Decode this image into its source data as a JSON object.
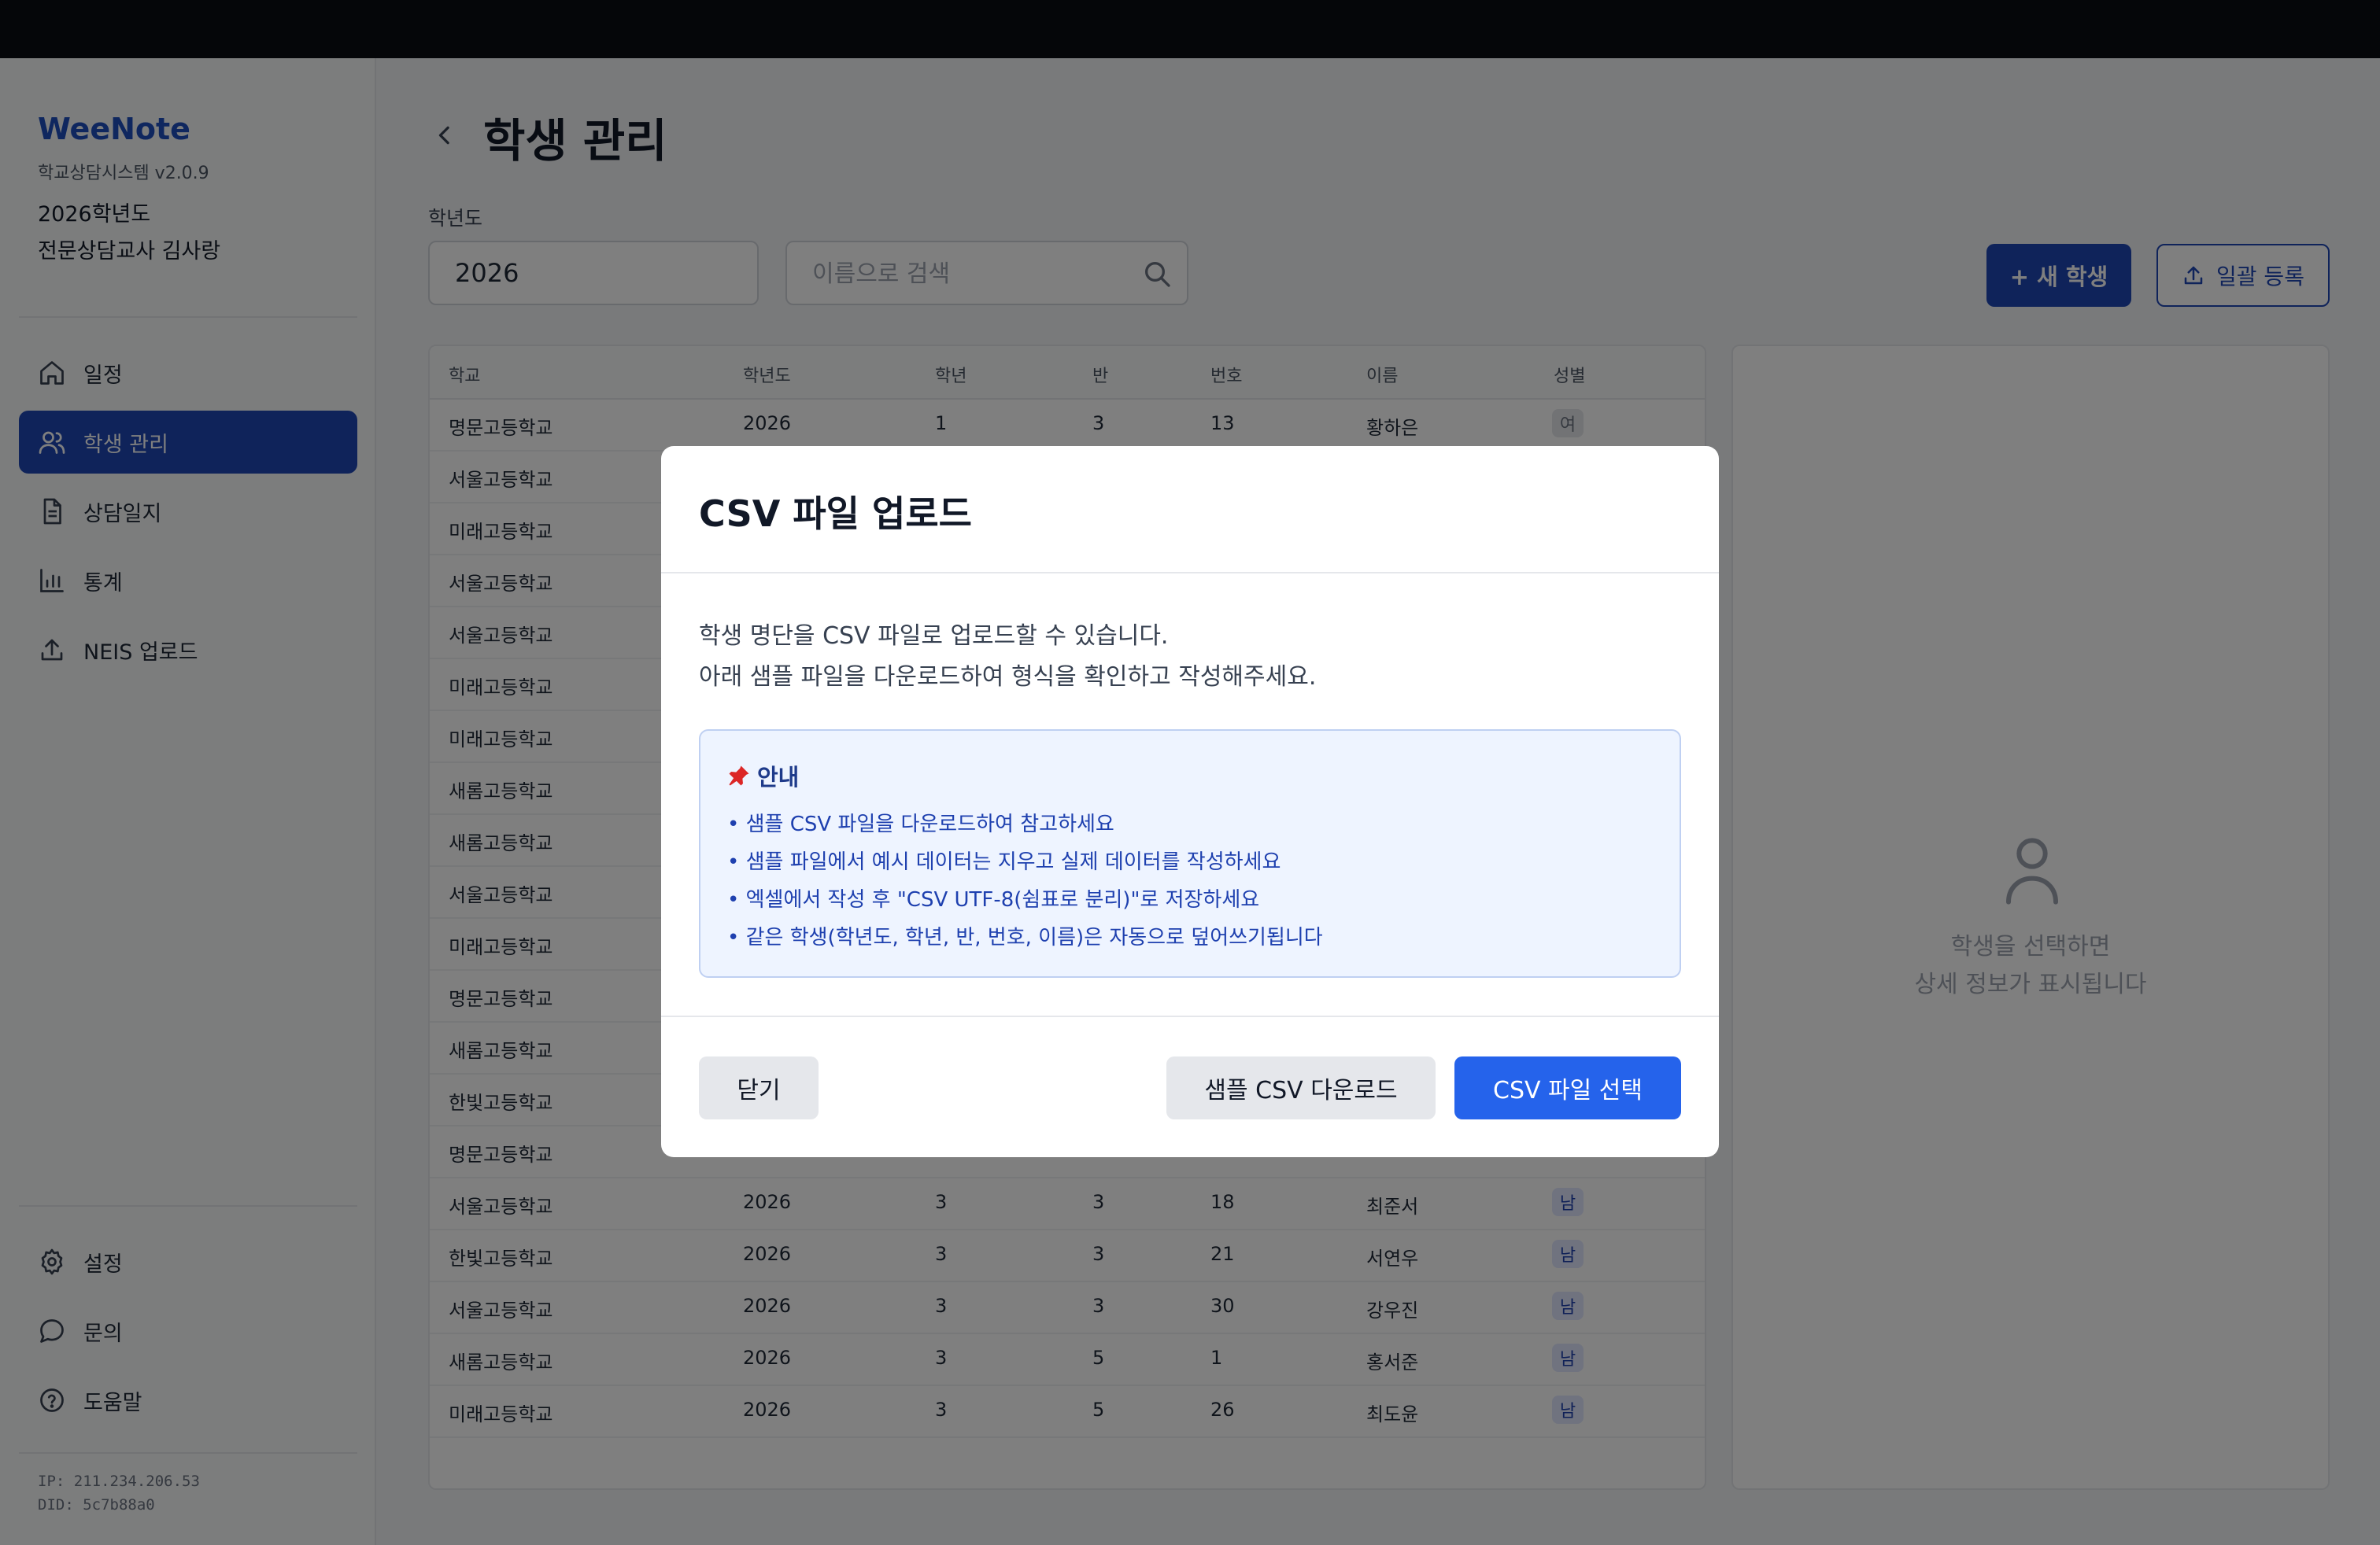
{
  "sidebar": {
    "brand": "WeeNote",
    "version": "학교상담시스템 v2.0.9",
    "school_year": "2026학년도",
    "user": "전문상담교사 김사랑",
    "nav": [
      {
        "label": "일정",
        "icon": "home-icon"
      },
      {
        "label": "학생 관리",
        "icon": "users-icon",
        "active": true
      },
      {
        "label": "상담일지",
        "icon": "document-icon"
      },
      {
        "label": "통계",
        "icon": "bar-chart-icon"
      },
      {
        "label": "NEIS 업로드",
        "icon": "upload-icon"
      }
    ],
    "bottom_nav": [
      {
        "label": "설정",
        "icon": "gear-icon"
      },
      {
        "label": "문의",
        "icon": "chat-bubble-icon"
      },
      {
        "label": "도움말",
        "icon": "help-circle-icon"
      }
    ],
    "ip": "IP: 211.234.206.53",
    "did": "DID: 5c7b88a0"
  },
  "main": {
    "title": "학생 관리",
    "year_label": "학년도",
    "year_value": "2026",
    "search_placeholder": "이름으로 검색",
    "new_button": "+ 새 학생",
    "bulk_button": "일괄 등록"
  },
  "table": {
    "headers": [
      "학교",
      "학년도",
      "학년",
      "반",
      "번호",
      "이름",
      "성별"
    ],
    "rows": [
      {
        "school": "명문고등학교",
        "year": "2026",
        "grade": "1",
        "class": "3",
        "number": "13",
        "name": "황하은",
        "gender": "여"
      },
      {
        "school": "서울고등학교"
      },
      {
        "school": "미래고등학교"
      },
      {
        "school": "서울고등학교"
      },
      {
        "school": "서울고등학교"
      },
      {
        "school": "미래고등학교"
      },
      {
        "school": "미래고등학교"
      },
      {
        "school": "새롬고등학교"
      },
      {
        "school": "새롬고등학교"
      },
      {
        "school": "서울고등학교"
      },
      {
        "school": "미래고등학교"
      },
      {
        "school": "명문고등학교"
      },
      {
        "school": "새롬고등학교"
      },
      {
        "school": "한빛고등학교"
      },
      {
        "school": "명문고등학교"
      },
      {
        "school": "서울고등학교",
        "year": "2026",
        "grade": "3",
        "class": "3",
        "number": "18",
        "name": "최준서",
        "gender": "남"
      },
      {
        "school": "한빛고등학교",
        "year": "2026",
        "grade": "3",
        "class": "3",
        "number": "21",
        "name": "서연우",
        "gender": "남"
      },
      {
        "school": "서울고등학교",
        "year": "2026",
        "grade": "3",
        "class": "3",
        "number": "30",
        "name": "강우진",
        "gender": "남"
      },
      {
        "school": "새롬고등학교",
        "year": "2026",
        "grade": "3",
        "class": "5",
        "number": "1",
        "name": "홍서준",
        "gender": "남"
      },
      {
        "school": "미래고등학교",
        "year": "2026",
        "grade": "3",
        "class": "5",
        "number": "26",
        "name": "최도윤",
        "gender": "남"
      }
    ]
  },
  "detail": {
    "empty_line1": "학생을 선택하면",
    "empty_line2": "상세 정보가 표시됩니다"
  },
  "modal": {
    "title": "CSV 파일 업로드",
    "desc_line1": "학생 명단을 CSV 파일로 업로드할 수 있습니다.",
    "desc_line2": "아래 샘플 파일을 다운로드하여 형식을 확인하고 작성해주세요.",
    "notice_title": "안내",
    "notice_items": [
      "• 샘플 CSV 파일을 다운로드하여 참고하세요",
      "• 샘플 파일에서 예시 데이터는 지우고 실제 데이터를 작성하세요",
      "• 엑셀에서 작성 후 \"CSV UTF-8(쉼표로 분리)\"로 저장하세요",
      "• 같은 학생(학년도, 학년, 반, 번호, 이름)은 자동으로 덮어쓰기됩니다"
    ],
    "close_button": "닫기",
    "sample_button": "샘플 CSV 다운로드",
    "select_button": "CSV 파일 선택"
  },
  "colors": {
    "accent": "#1e47b5",
    "primary_button": "#2563eb",
    "notice_bg": "#eef4ff"
  }
}
